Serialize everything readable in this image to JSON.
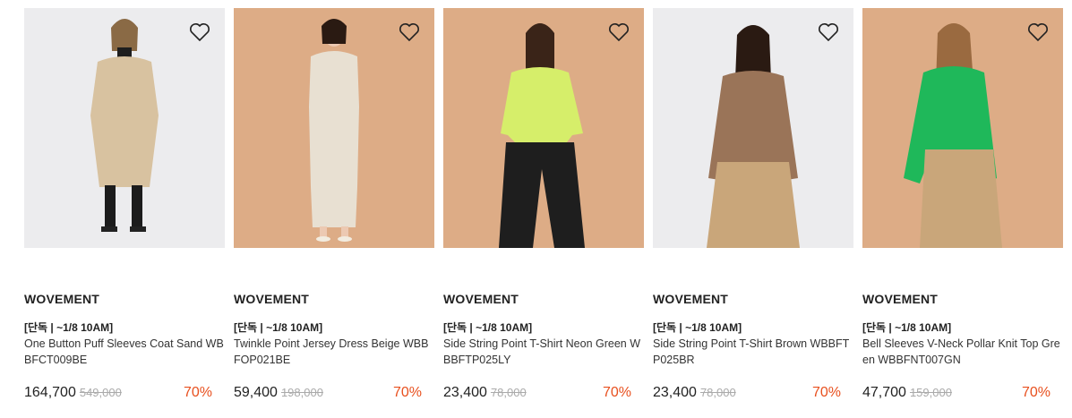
{
  "products": [
    {
      "brand": "WOVEMENT",
      "tag": "[단독 | ~1/8 10AM]",
      "name": "One Button Puff Sleeves Coat Sand WBBFCT009BE",
      "price": "164,700",
      "original_price": "549,000",
      "discount": "70%",
      "bg": "#ececee",
      "top_color": "#d8c2a0",
      "bottom_color": "#1c1c1c"
    },
    {
      "brand": "WOVEMENT",
      "tag": "[단독 | ~1/8 10AM]",
      "name": "Twinkle Point Jersey Dress Beige WBBFOP021BE",
      "price": "59,400",
      "original_price": "198,000",
      "discount": "70%",
      "bg": "#ddac86",
      "top_color": "#e8e0d2",
      "bottom_color": "#e8e0d2"
    },
    {
      "brand": "WOVEMENT",
      "tag": "[단독 | ~1/8 10AM]",
      "name": "Side String Point T-Shirt Neon Green WBBFTP025LY",
      "price": "23,400",
      "original_price": "78,000",
      "discount": "70%",
      "bg": "#ddac86",
      "top_color": "#d6ee6a",
      "bottom_color": "#1e1e1e"
    },
    {
      "brand": "WOVEMENT",
      "tag": "[단독 | ~1/8 10AM]",
      "name": "Side String Point T-Shirt Brown WBBFTP025BR",
      "price": "23,400",
      "original_price": "78,000",
      "discount": "70%",
      "bg": "#ececee",
      "top_color": "#9a7458",
      "bottom_color": "#c9a67a"
    },
    {
      "brand": "WOVEMENT",
      "tag": "[단독 | ~1/8 10AM]",
      "name": "Bell Sleeves V-Neck Pollar Knit Top Green WBBFNT007GN",
      "price": "47,700",
      "original_price": "159,000",
      "discount": "70%",
      "bg": "#ddac86",
      "top_color": "#1fb85a",
      "bottom_color": "#c9a67a"
    }
  ],
  "icons": {
    "wishlist": "heart-outline-icon"
  },
  "colors": {
    "discount": "#e8501e",
    "text": "#222222",
    "strike": "#aaaaaa"
  }
}
